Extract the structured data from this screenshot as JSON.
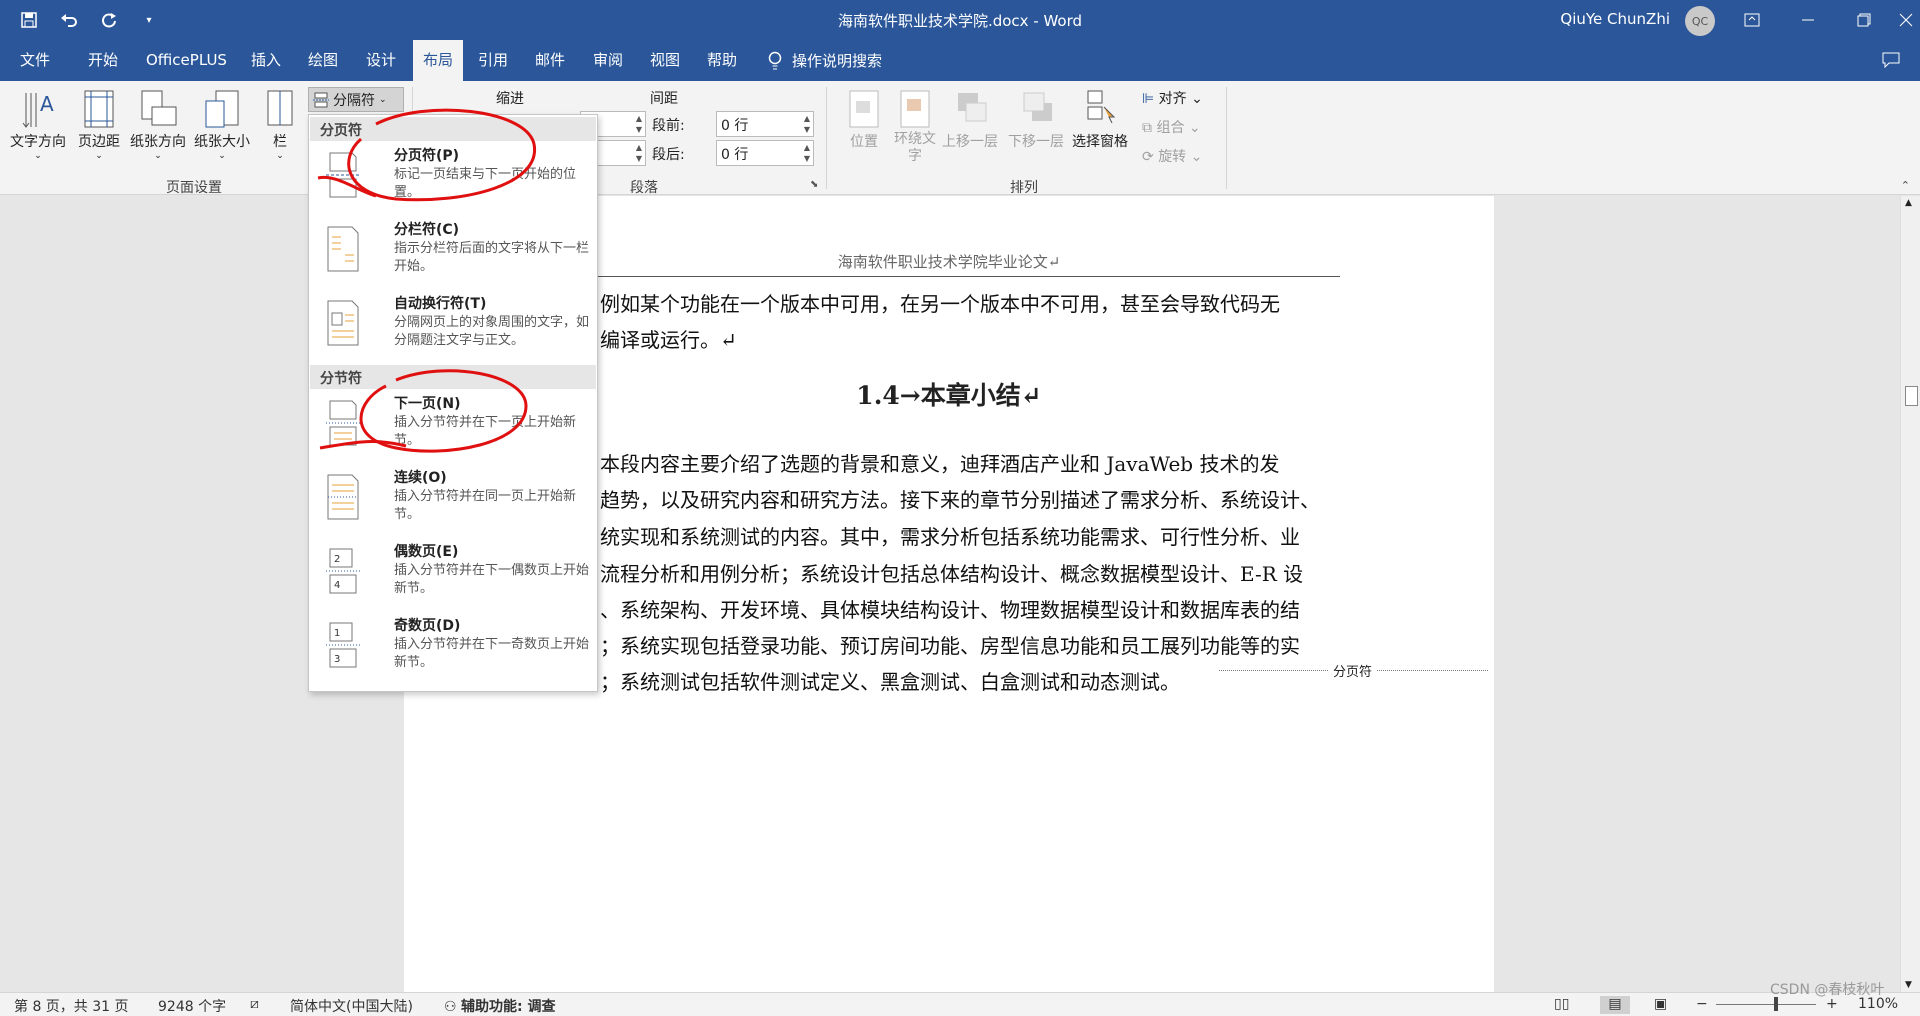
{
  "title_bar": {
    "document_title": "海南软件职业技术学院.docx  -  Word",
    "user_name": "QiuYe ChunZhi",
    "avatar_initials": "QC",
    "qat_icons": [
      "save-icon",
      "undo-icon",
      "redo-icon",
      "customize-icon"
    ]
  },
  "tabs": [
    "文件",
    "开始",
    "OfficePLUS",
    "插入",
    "绘图",
    "设计",
    "布局",
    "引用",
    "邮件",
    "审阅",
    "视图",
    "帮助"
  ],
  "active_tab": "布局",
  "tell_me": "操作说明搜索",
  "ribbon": {
    "page_setup": {
      "label": "页面设置",
      "buttons": [
        "文字方向",
        "页边距",
        "纸张方向",
        "纸张大小",
        "栏"
      ],
      "breaks_button": "分隔符"
    },
    "paragraph": {
      "label": "段落",
      "indent_label": "缩进",
      "spacing_label": "间距",
      "before_label": "段前:",
      "before_value": "0 行",
      "after_label": "段后:",
      "after_value": "0 行"
    },
    "arrange": {
      "label": "排列",
      "buttons": [
        "位置",
        "环绕文字",
        "上移一层",
        "下移一层",
        "选择窗格"
      ],
      "align": "对齐",
      "group": "组合",
      "rotate": "旋转"
    }
  },
  "breaks_menu": {
    "page_breaks_header": "分页符",
    "section_breaks_header": "分节符",
    "items": [
      {
        "title": "分页符(P)",
        "desc": "标记一页结束与下一页开始的位置。"
      },
      {
        "title": "分栏符(C)",
        "desc": "指示分栏符后面的文字将从下一栏开始。"
      },
      {
        "title": "自动换行符(T)",
        "desc": "分隔网页上的对象周围的文字，如分隔题注文字与正文。"
      },
      {
        "title": "下一页(N)",
        "desc": "插入分节符并在下一页上开始新节。"
      },
      {
        "title": "连续(O)",
        "desc": "插入分节符并在同一页上开始新节。"
      },
      {
        "title": "偶数页(E)",
        "desc": "插入分节符并在下一偶数页上开始新节。"
      },
      {
        "title": "奇数页(D)",
        "desc": "插入分节符并在下一奇数页上开始新节。"
      }
    ]
  },
  "document": {
    "header": "海南软件职业技术学院毕业论文↵",
    "lines_top": [
      "例如某个功能在一个版本中可用，在另一个版本中不可用，甚至会导致代码无",
      "编译或运行。↵"
    ],
    "heading": "1.4→本章小结↵",
    "lines": [
      "本段内容主要介绍了选题的背景和意义，迪拜酒店产业和 JavaWeb 技术的发",
      "趋势，以及研究内容和研究方法。接下来的章节分别描述了需求分析、系统设计、",
      "统实现和系统测试的内容。其中，需求分析包括系统功能需求、可行性分析、业",
      "流程分析和用例分析；系统设计包括总体结构设计、概念数据模型设计、E-R 设",
      "、系统架构、开发环境、具体模块结构设计、物理数据模型设计和数据库表的结",
      "；系统实现包括登录功能、预订房间功能、房型信息功能和员工展列功能等的实",
      "；系统测试包括软件测试定义、黑盒测试、白盒测试和动态测试。"
    ],
    "page_break_label": "分页符"
  },
  "status_bar": {
    "page": "第 8 页，共 31 页",
    "words": "9248 个字",
    "language": "简体中文(中国大陆)",
    "accessibility": "辅助功能: 调查",
    "zoom": "110%",
    "watermark": "CSDN @春枝秋叶"
  }
}
